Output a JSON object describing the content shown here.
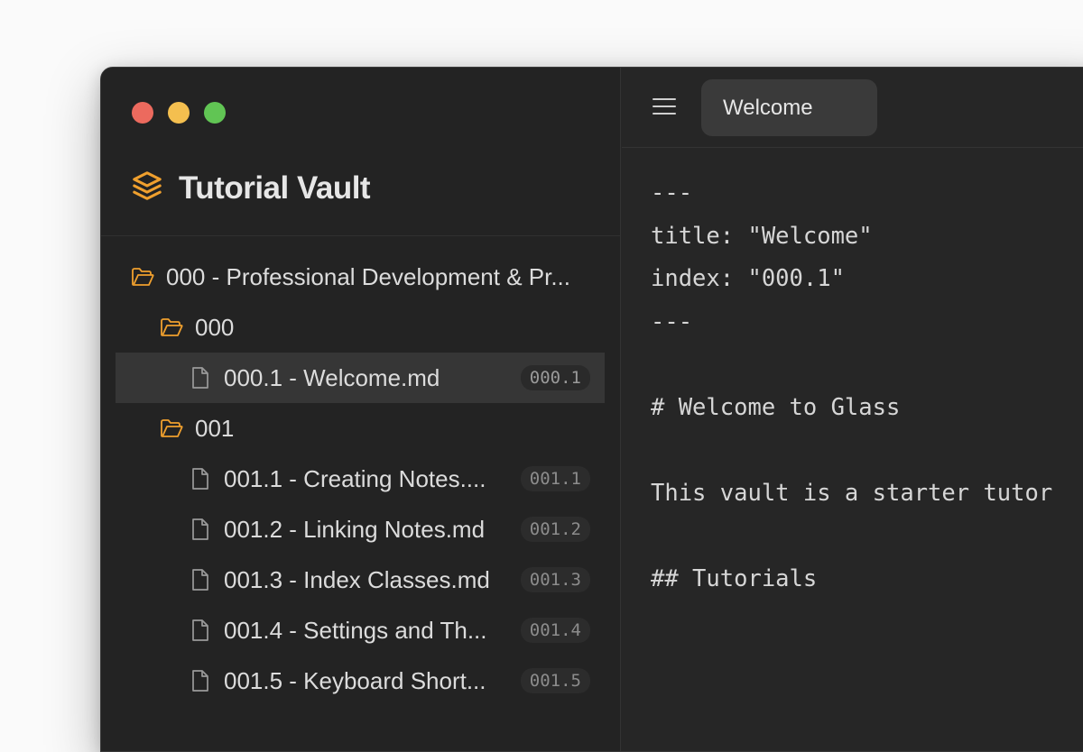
{
  "window": {
    "traffic_lights": [
      "close",
      "minimize",
      "zoom"
    ]
  },
  "sidebar": {
    "vault_icon": "stacked-layers-icon",
    "vault_title": "Tutorial Vault",
    "tree": [
      {
        "type": "folder",
        "level": 0,
        "label": "000 - Professional Development & Pr..."
      },
      {
        "type": "folder",
        "level": 1,
        "label": "000"
      },
      {
        "type": "file",
        "level": 2,
        "label": "000.1 - Welcome.md",
        "badge": "000.1",
        "selected": true
      },
      {
        "type": "folder",
        "level": 1,
        "label": "001"
      },
      {
        "type": "file",
        "level": 2,
        "label": "001.1 - Creating Notes....",
        "badge": "001.1"
      },
      {
        "type": "file",
        "level": 2,
        "label": "001.2 - Linking Notes.md",
        "badge": "001.2"
      },
      {
        "type": "file",
        "level": 2,
        "label": "001.3 - Index Classes.md",
        "badge": "001.3"
      },
      {
        "type": "file",
        "level": 2,
        "label": "001.4 - Settings and Th...",
        "badge": "001.4"
      },
      {
        "type": "file",
        "level": 2,
        "label": "001.5 - Keyboard Short...",
        "badge": "001.5"
      }
    ]
  },
  "toolbar": {
    "menu_icon": "hamburger-menu-icon",
    "active_tab": "Welcome"
  },
  "editor": {
    "lines": [
      "---",
      "title: \"Welcome\"",
      "index: \"000.1\"",
      "---",
      "",
      "# Welcome to Glass",
      "",
      "This vault is a starter tutor",
      "",
      "## Tutorials"
    ]
  },
  "colors": {
    "accent_folder": "#f0a02e",
    "window_bg": "#262626",
    "sidebar_bg": "#232323",
    "selected_row": "#363636",
    "traffic_red": "#ec6a5e",
    "traffic_yellow": "#f4bf4f",
    "traffic_green": "#61c554"
  }
}
